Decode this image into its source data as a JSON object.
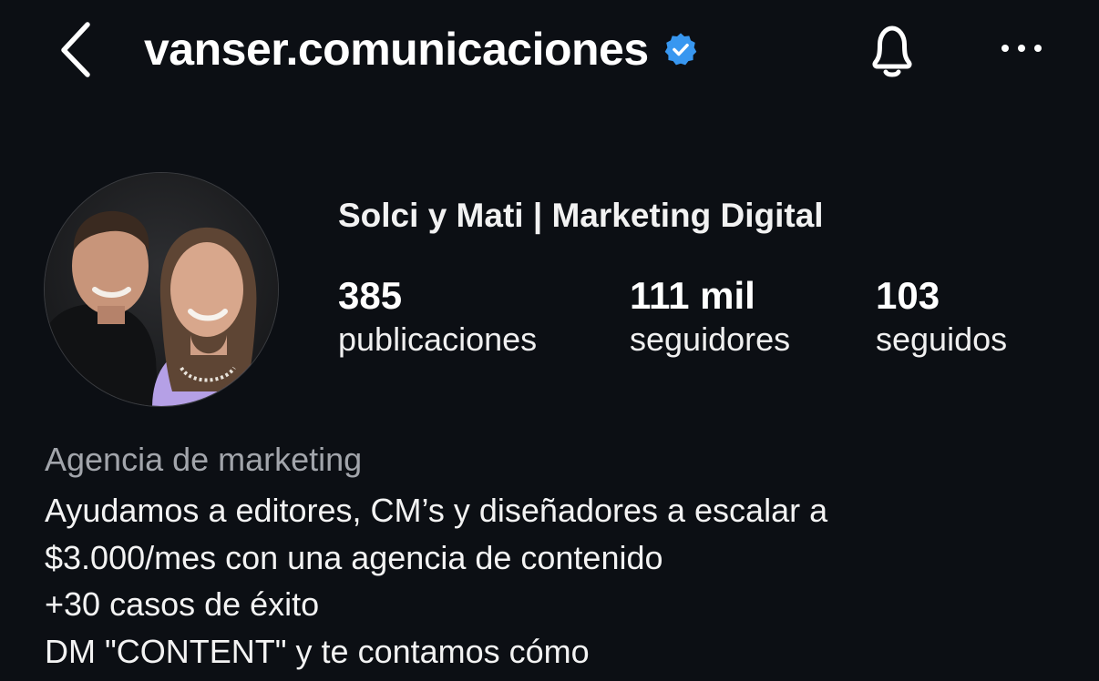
{
  "header": {
    "username": "vanser.comunicaciones",
    "verified": true,
    "icons": {
      "back": "chevron-left-icon",
      "verified": "verified-badge-icon",
      "notifications": "bell-icon",
      "more": "more-horizontal-icon"
    },
    "accent_color": "#3897f0"
  },
  "profile": {
    "display_name": "Solci y Mati | Marketing Digital",
    "stats": {
      "posts": {
        "value": "385",
        "label": "publicaciones"
      },
      "followers": {
        "value": "111 mil",
        "label": "seguidores"
      },
      "following": {
        "value": "103",
        "label": "seguidos"
      }
    }
  },
  "bio": {
    "category": "Agencia de marketing",
    "lines": [
      "Ayudamos a editores, CM’s y diseñadores a escalar a",
      "$3.000/mes con una agencia de contenido",
      "+30 casos de éxito",
      "DM \"CONTENT\" y te contamos cómo"
    ]
  },
  "colors": {
    "background": "#0c0f14",
    "text_primary": "#f5f5f5",
    "text_secondary": "#a2a5ab"
  }
}
